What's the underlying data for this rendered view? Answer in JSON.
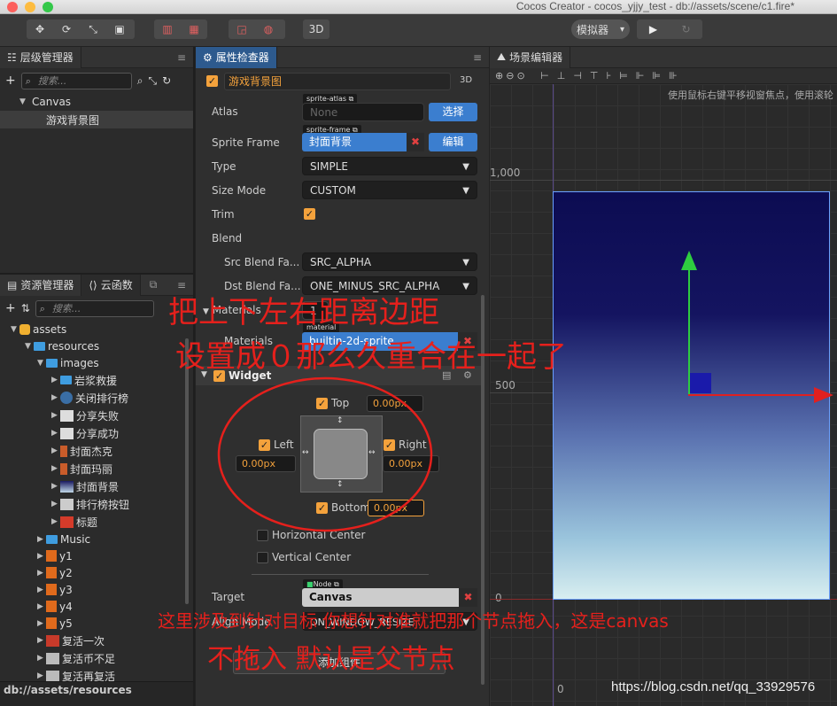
{
  "window": {
    "title": "Cocos Creator - cocos_yjjy_test - db://assets/scene/c1.fire*"
  },
  "toolbar": {
    "mode_3d": "3D",
    "simulator": "模拟器",
    "simulator_arrow": "▾",
    "play_icon": "▶",
    "refresh_icon": "↻"
  },
  "hierarchy": {
    "tab": "层级管理器",
    "search_placeholder": "搜索...",
    "nodes": [
      {
        "label": "Canvas"
      },
      {
        "label": "游戏背景图"
      }
    ]
  },
  "assets": {
    "tab": "资源管理器",
    "tab2": "云函数",
    "search_placeholder": "搜索...",
    "items": [
      {
        "label": "assets"
      },
      {
        "label": "resources"
      },
      {
        "label": "images"
      },
      {
        "label": "岩浆救援"
      },
      {
        "label": "关闭排行榜"
      },
      {
        "label": "分享失败"
      },
      {
        "label": "分享成功"
      },
      {
        "label": "封面杰克"
      },
      {
        "label": "封面玛丽"
      },
      {
        "label": "封面背景"
      },
      {
        "label": "排行榜按钮"
      },
      {
        "label": "标题"
      },
      {
        "label": "Music"
      },
      {
        "label": "y1"
      },
      {
        "label": "y2"
      },
      {
        "label": "y3"
      },
      {
        "label": "y4"
      },
      {
        "label": "y5"
      },
      {
        "label": "复活一次"
      },
      {
        "label": "复活币不足"
      },
      {
        "label": "复活再复活"
      }
    ],
    "path": "db://assets/resources"
  },
  "inspector": {
    "tab": "属性检查器",
    "node_name": "游戏背景图",
    "mode_3d": "3D",
    "sprite": {
      "atlas_label": "Atlas",
      "atlas_tag": "sprite-atlas",
      "atlas_value": "None",
      "atlas_btn": "选择",
      "frame_label": "Sprite Frame",
      "frame_tag": "sprite-frame",
      "frame_value": "封面背景",
      "frame_btn": "编辑",
      "type_label": "Type",
      "type_value": "SIMPLE",
      "size_label": "Size Mode",
      "size_value": "CUSTOM",
      "trim_label": "Trim",
      "blend_label": "Blend",
      "src_label": "Src Blend Fa...",
      "src_value": "SRC_ALPHA",
      "dst_label": "Dst Blend Fa...",
      "dst_value": "ONE_MINUS_SRC_ALPHA",
      "materials_label": "Materials",
      "materials_count": "1",
      "material_label": "Materials",
      "material_tag": "material",
      "material_value": "builtin-2d-sprite"
    },
    "widget": {
      "title": "Widget",
      "top_label": "Top",
      "top_value": "0.00px",
      "left_label": "Left",
      "left_value": "0.00px",
      "right_label": "Right",
      "right_value": "0.00px",
      "bottom_label": "Bottom",
      "bottom_value": "0.00px",
      "hcenter": "Horizontal Center",
      "vcenter": "Vertical Center",
      "target_label": "Target",
      "target_tag": "Node",
      "target_value": "Canvas",
      "align_label": "Align Mode",
      "align_value": "ON_WINDOW_RESIZE"
    },
    "add_component": "添加组件"
  },
  "scene": {
    "tab": "场景编辑器",
    "hint": "使用鼠标右键平移视窗焦点，使用滚轮",
    "y_1000": "1,000",
    "y_500": "500",
    "y_0": "0",
    "x_0": "0"
  },
  "annotations": {
    "line1": "把上下左右距离边距",
    "line2": "设置成０那么久重合在一起了",
    "line3": "这里涉及到针对目标 你想针对谁就把那个节点拖入，这是canvas",
    "line4": "不拖入 默认是父节点"
  },
  "watermark": "https://blog.csdn.net/qq_33929576",
  "colors": {
    "accent": "#3b7ecf",
    "checkbox": "#f4a23c",
    "annotation": "#e5201c"
  }
}
